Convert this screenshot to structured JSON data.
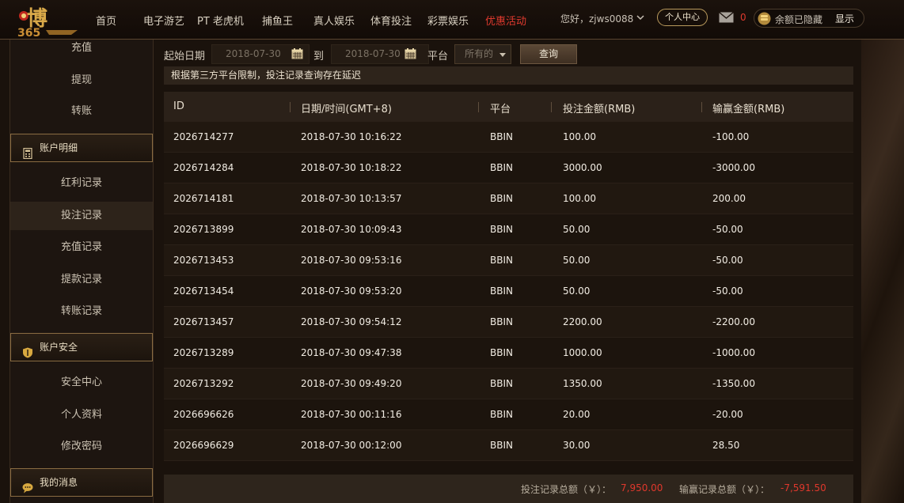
{
  "header": {
    "logo_text": "博365",
    "nav": [
      {
        "label": "首页"
      },
      {
        "label": "电子游艺"
      },
      {
        "label": "PT 老虎机"
      },
      {
        "label": "捕鱼王"
      },
      {
        "label": "真人娱乐"
      },
      {
        "label": "体育投注"
      },
      {
        "label": "彩票娱乐"
      },
      {
        "label": "优惠活动"
      }
    ],
    "greeting": "您好，zjws0088",
    "user_center": "个人中心",
    "mail_count": "0",
    "balance_text": "余额已隐藏",
    "show_label": "显示"
  },
  "sidebar": {
    "funds": [
      "充值",
      "提现",
      "转账"
    ],
    "section_account": "账户明细",
    "records": [
      "红利记录",
      "投注记录",
      "充值记录",
      "提款记录",
      "转账记录"
    ],
    "active_record": "投注记录",
    "section_security": "账户安全",
    "security": [
      "安全中心",
      "个人资料",
      "修改密码"
    ],
    "section_messages": "我的消息"
  },
  "filter": {
    "start_label": "起始日期",
    "start_value": "2018-07-30",
    "to_label": "到",
    "end_value": "2018-07-30",
    "platform_label": "平台",
    "platform_value": "所有的",
    "query_label": "查询"
  },
  "notice": "根据第三方平台限制，投注记录查询存在延迟",
  "table": {
    "headers": [
      "ID",
      "日期/时间(GMT+8)",
      "平台",
      "投注金额(RMB)",
      "输赢金额(RMB)"
    ],
    "rows": [
      [
        "2026714277",
        "2018-07-30 10:16:22",
        "BBIN",
        "100.00",
        "-100.00"
      ],
      [
        "2026714284",
        "2018-07-30 10:18:22",
        "BBIN",
        "3000.00",
        "-3000.00"
      ],
      [
        "2026714181",
        "2018-07-30 10:13:57",
        "BBIN",
        "100.00",
        "200.00"
      ],
      [
        "2026713899",
        "2018-07-30 10:09:43",
        "BBIN",
        "50.00",
        "-50.00"
      ],
      [
        "2026713453",
        "2018-07-30 09:53:16",
        "BBIN",
        "50.00",
        "-50.00"
      ],
      [
        "2026713454",
        "2018-07-30 09:53:20",
        "BBIN",
        "50.00",
        "-50.00"
      ],
      [
        "2026713457",
        "2018-07-30 09:54:12",
        "BBIN",
        "2200.00",
        "-2200.00"
      ],
      [
        "2026713289",
        "2018-07-30 09:47:38",
        "BBIN",
        "1000.00",
        "-1000.00"
      ],
      [
        "2026713292",
        "2018-07-30 09:49:20",
        "BBIN",
        "1350.00",
        "-1350.00"
      ],
      [
        "2026696626",
        "2018-07-30 00:11:16",
        "BBIN",
        "20.00",
        "-20.00"
      ],
      [
        "2026696629",
        "2018-07-30 00:12:00",
        "BBIN",
        "30.00",
        "28.50"
      ]
    ]
  },
  "totals": {
    "bet_label": "投注记录总额（￥）：",
    "bet_value": "7,950.00",
    "win_label": "输赢记录总额（￥）：",
    "win_value": "-7,591.50"
  },
  "colors": {
    "accent_red": "#e03a2e",
    "gold_border": "#b99a5c"
  }
}
